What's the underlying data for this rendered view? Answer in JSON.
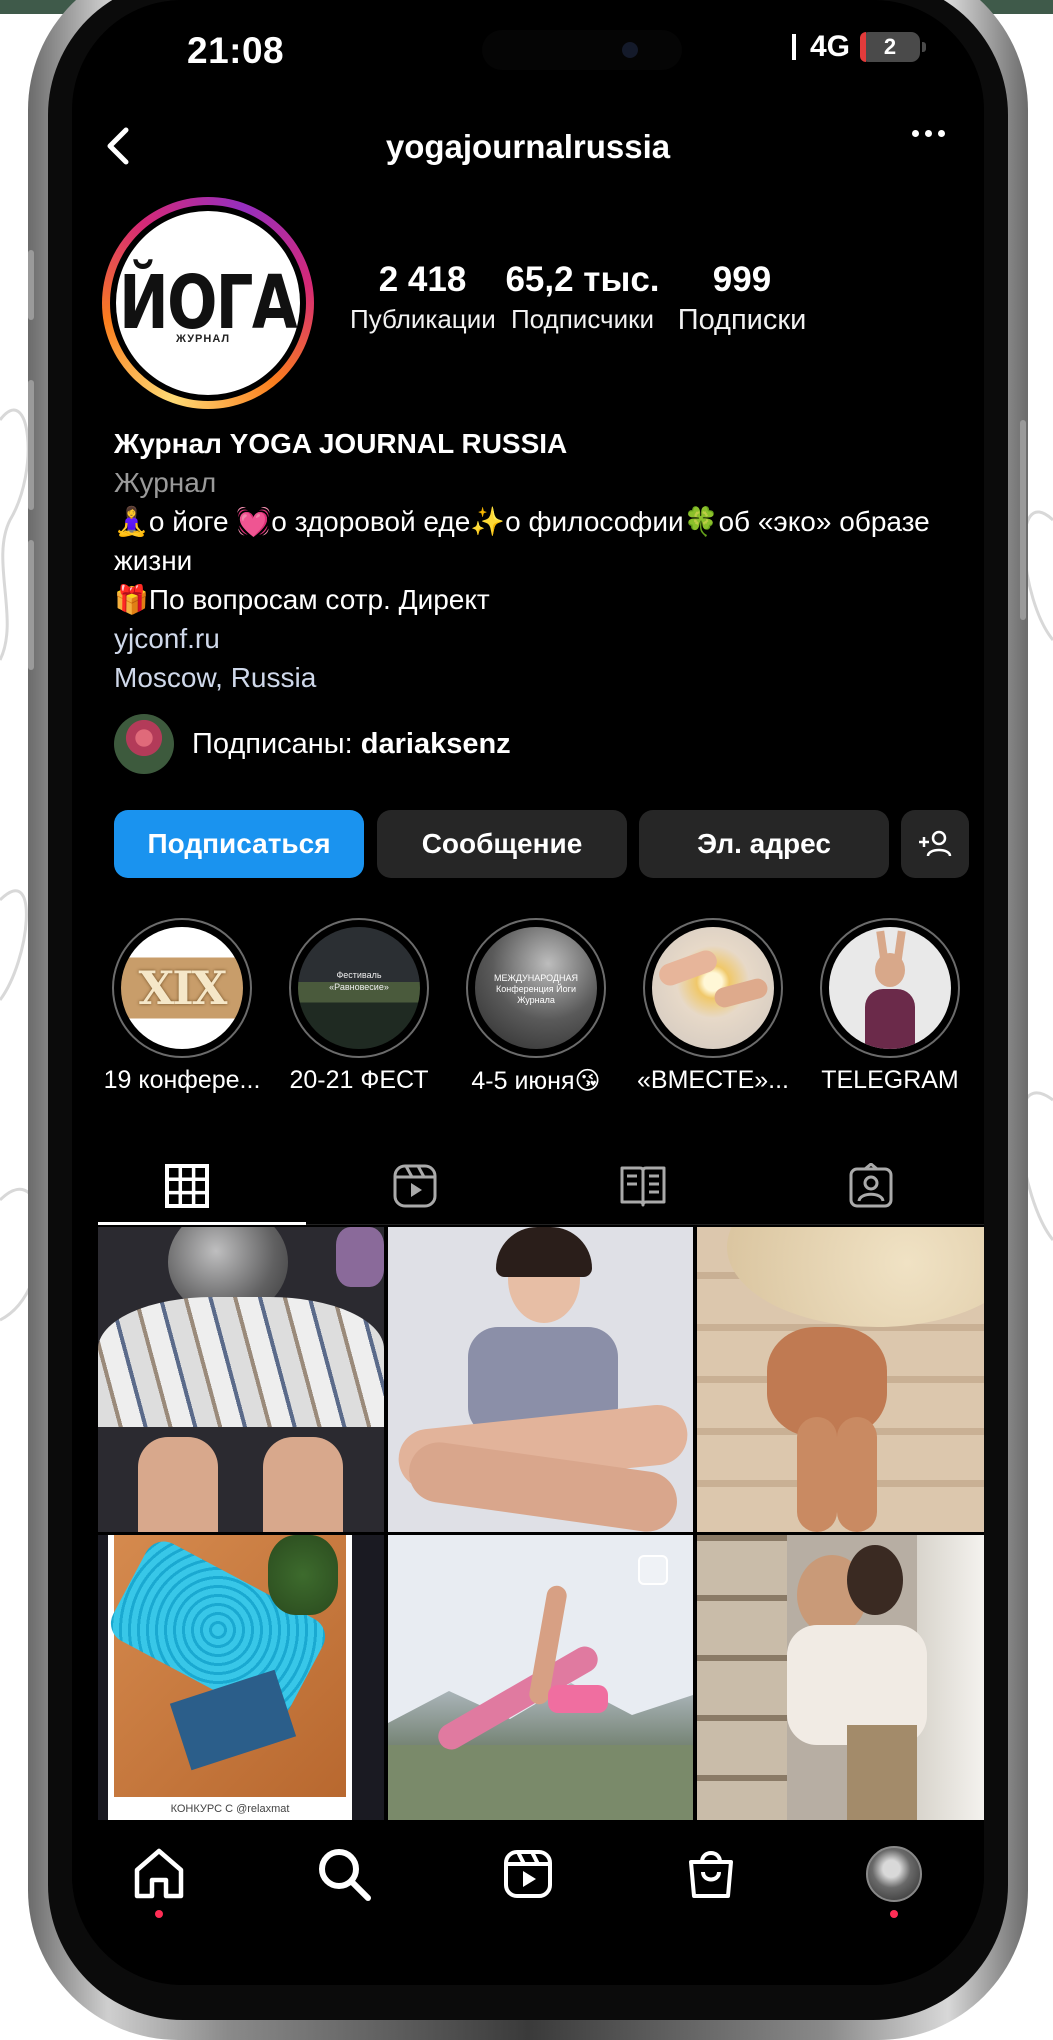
{
  "status_bar": {
    "time": "21:08",
    "network": "4G",
    "battery": "2"
  },
  "header": {
    "username": "yogajournalrussia",
    "back_icon": "chevron-left-icon",
    "more_icon": "more-horizontal-icon"
  },
  "profile": {
    "avatar_logo": "ЙОГА",
    "avatar_logo_sub": "ЖУРНАЛ",
    "stats": [
      {
        "value": "2 418",
        "label": "Публикации"
      },
      {
        "value": "65,2 тыс.",
        "label": "Подписчики"
      },
      {
        "value": "999",
        "label": "Подписки"
      }
    ],
    "name": "Журнал YOGA JOURNAL RUSSIA",
    "category": "Журнал",
    "bio_line1": "🧘‍♀️о йоге 💓о здоровой еде✨о философии🍀об «эко» образе жизни",
    "bio_line2": "🎁По вопросам сотр. Директ",
    "link": "yjconf.ru",
    "location": "Moscow, Russia",
    "followed_by_prefix": "Подписаны: ",
    "followed_by_user": "dariaksenz"
  },
  "actions": {
    "follow": "Подписаться",
    "message": "Сообщение",
    "email": "Эл. адрес",
    "add_user_icon": "add-user-icon"
  },
  "highlights": [
    {
      "label": "19 конфере...",
      "image_text": "XIX"
    },
    {
      "label": "20-21 ФЕСТ",
      "image_text": "Фестиваль «Равновесие»"
    },
    {
      "label": "4-5 июня😘",
      "image_text": "МЕЖДУНАРОДНАЯ Конференция Йоги Журнала"
    },
    {
      "label": "«ВМЕСТЕ»...",
      "image_text": ""
    },
    {
      "label": "TELEGRAM",
      "image_text": ""
    }
  ],
  "tabs": [
    {
      "name": "grid",
      "icon": "grid-icon"
    },
    {
      "name": "reels",
      "icon": "reels-icon"
    },
    {
      "name": "guides",
      "icon": "guides-icon"
    },
    {
      "name": "tagged",
      "icon": "tagged-icon"
    }
  ],
  "grid_posts": [
    {
      "id": "tarot"
    },
    {
      "id": "portrait"
    },
    {
      "id": "hat"
    },
    {
      "id": "mat",
      "caption": "КОНКУРС С @relaxmat"
    },
    {
      "id": "yoga-pose"
    },
    {
      "id": "couple"
    }
  ],
  "bottom_nav": [
    {
      "name": "home",
      "icon": "home-icon"
    },
    {
      "name": "search",
      "icon": "search-icon"
    },
    {
      "name": "reels",
      "icon": "reels-icon"
    },
    {
      "name": "shop",
      "icon": "shop-icon"
    },
    {
      "name": "profile",
      "icon": "profile-avatar"
    }
  ],
  "colors": {
    "primary": "#1a93ef",
    "background": "#000000",
    "button_dark": "#262626",
    "notification_dot": "#ff2d55"
  }
}
